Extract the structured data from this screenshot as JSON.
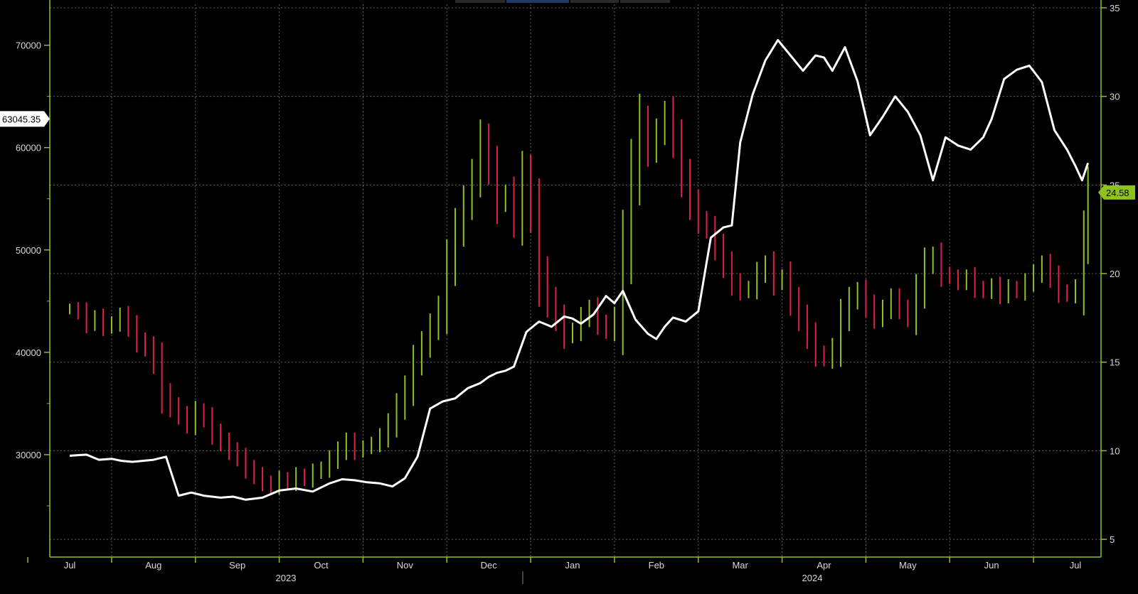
{
  "chart_data": {
    "type": "line",
    "title": "",
    "xlabel": "",
    "ylabel_left": "",
    "ylabel_right": "",
    "grid": true,
    "colors": {
      "background": "#000000",
      "axis": "#8fc21f",
      "grid": "#8a8a8a",
      "price_line": "#ffffff",
      "bar_up": "#8fc21f",
      "bar_down": "#e0204a",
      "label_right_bg": "#8fc21f"
    },
    "x_tick_labels": [
      "Jul",
      "Aug",
      "Sep",
      "Oct",
      "Nov",
      "Dec",
      "Jan",
      "Feb",
      "Mar",
      "Apr",
      "May",
      "Jun",
      "Jul"
    ],
    "x_year_labels": [
      "2023",
      "2024"
    ],
    "y_left": {
      "ticks": [
        "30000",
        "40000",
        "50000",
        "60000",
        "70000"
      ],
      "ylim": [
        20000,
        74000
      ],
      "last_value_label": "63045.35"
    },
    "y_right": {
      "ticks": [
        "5",
        "10",
        "15",
        "20",
        "25",
        "30",
        "35"
      ],
      "ylim": [
        4,
        35.2
      ],
      "last_value_label": "24.58"
    },
    "series": [
      {
        "axis": "left",
        "style": "line",
        "x_month_index": [
          0,
          0.2,
          0.35,
          0.5,
          0.62,
          0.75,
          1.0,
          1.15,
          1.3,
          1.45,
          1.6,
          1.8,
          1.95,
          2.1,
          2.3,
          2.5,
          2.7,
          2.9,
          3.1,
          3.25,
          3.4,
          3.55,
          3.7,
          3.85,
          4.0,
          4.15,
          4.3,
          4.45,
          4.6,
          4.75,
          4.9,
          5.0,
          5.1,
          5.2,
          5.3,
          5.45,
          5.6,
          5.75,
          5.9,
          6.0,
          6.1,
          6.25,
          6.4,
          6.5,
          6.6,
          6.75,
          6.9,
          7.0,
          7.1,
          7.2,
          7.35,
          7.5,
          7.65,
          7.8,
          7.9,
          8.0,
          8.15,
          8.3,
          8.45,
          8.6,
          8.75,
          8.9,
          9.0,
          9.1,
          9.25,
          9.4,
          9.55,
          9.7,
          9.85,
          10.0,
          10.15,
          10.3,
          10.45,
          10.6,
          10.75,
          10.9,
          11.0,
          11.15,
          11.3,
          11.45,
          11.6,
          11.75,
          11.9,
          12.0,
          12.08,
          12.15
        ],
        "values": [
          29900,
          30000,
          29500,
          29600,
          29400,
          29300,
          29500,
          29800,
          26000,
          26300,
          26000,
          25800,
          25900,
          25600,
          25800,
          26500,
          26700,
          26400,
          27200,
          27600,
          27500,
          27300,
          27200,
          26900,
          27700,
          29800,
          34500,
          35200,
          35500,
          36500,
          37000,
          37600,
          38000,
          38200,
          38600,
          42000,
          43000,
          42500,
          43500,
          43300,
          42800,
          43700,
          45500,
          44800,
          46000,
          43200,
          41800,
          41300,
          42500,
          43400,
          43000,
          44000,
          51200,
          52200,
          52400,
          60500,
          65200,
          68500,
          70500,
          69000,
          67500,
          69000,
          68800,
          67500,
          69800,
          66500,
          61200,
          63000,
          65000,
          63500,
          61200,
          56800,
          61000,
          60200,
          59800,
          61000,
          62800,
          66700,
          67600,
          68000,
          66400,
          61700,
          59800,
          58200,
          56800,
          58500,
          60000,
          63000,
          62800
        ]
      },
      {
        "axis": "right",
        "style": "bars",
        "x_month_index": [
          0,
          0.1,
          0.2,
          0.3,
          0.4,
          0.5,
          0.6,
          0.7,
          0.8,
          0.9,
          1.0,
          1.1,
          1.2,
          1.3,
          1.4,
          1.5,
          1.6,
          1.7,
          1.8,
          1.9,
          2.0,
          2.1,
          2.2,
          2.3,
          2.4,
          2.5,
          2.6,
          2.7,
          2.8,
          2.9,
          3.0,
          3.1,
          3.2,
          3.3,
          3.4,
          3.5,
          3.6,
          3.7,
          3.8,
          3.9,
          4.0,
          4.1,
          4.2,
          4.3,
          4.4,
          4.5,
          4.6,
          4.7,
          4.8,
          4.9,
          5.0,
          5.1,
          5.2,
          5.3,
          5.4,
          5.5,
          5.6,
          5.7,
          5.8,
          5.9,
          6.0,
          6.1,
          6.2,
          6.3,
          6.4,
          6.5,
          6.6,
          6.7,
          6.8,
          6.9,
          7.0,
          7.1,
          7.2,
          7.3,
          7.4,
          7.5,
          7.6,
          7.7,
          7.8,
          7.9,
          8.0,
          8.1,
          8.2,
          8.3,
          8.4,
          8.5,
          8.6,
          8.7,
          8.8,
          8.9,
          9.0,
          9.1,
          9.2,
          9.3,
          9.4,
          9.5,
          9.6,
          9.7,
          9.8,
          9.9,
          10.0,
          10.1,
          10.2,
          10.3,
          10.4,
          10.5,
          10.6,
          10.7,
          10.8,
          10.9,
          11.0,
          11.1,
          11.2,
          11.3,
          11.4,
          11.5,
          11.6,
          11.7,
          11.8,
          11.9,
          12.0,
          12.1,
          12.15
        ],
        "values": [
          18.0,
          17.8,
          17.2,
          17.5,
          17.0,
          17.2,
          17.6,
          17.0,
          16.2,
          15.8,
          15.0,
          13.2,
          12.5,
          12.0,
          11.5,
          12.2,
          11.8,
          11.0,
          10.5,
          10.0,
          9.6,
          9.0,
          8.6,
          8.2,
          8.0,
          8.4,
          8.2,
          8.6,
          8.4,
          8.8,
          9.0,
          9.5,
          10.0,
          10.5,
          10.0,
          10.2,
          10.4,
          10.8,
          11.5,
          12.5,
          13.5,
          15.0,
          16.0,
          17.0,
          18.0,
          20.5,
          22.5,
          24.0,
          25.5,
          27.5,
          26.0,
          24.0,
          24.5,
          23.0,
          25.5,
          23.5,
          20.0,
          18.5,
          17.5,
          16.5,
          16.8,
          17.5,
          18.0,
          17.2,
          16.8,
          17.5,
          21.5,
          25.5,
          28.5,
          27.0,
          28.0,
          29.0,
          27.5,
          25.5,
          24.0,
          23.0,
          22.5,
          21.5,
          20.5,
          19.5,
          19.0,
          19.2,
          20.0,
          20.5,
          19.5,
          19.8,
          18.5,
          17.5,
          16.5,
          15.5,
          15.2,
          15.8,
          17.5,
          18.5,
          19.0,
          18.2,
          17.5,
          18.0,
          18.6,
          18.0,
          17.5,
          19.0,
          20.5,
          21.0,
          20.0,
          19.8,
          19.5,
          19.8,
          19.2,
          19.0,
          19.3,
          18.8,
          19.2,
          19.0,
          19.5,
          20.0,
          20.5,
          19.8,
          19.0,
          18.8,
          19.2,
          22.0,
          24.58
        ]
      }
    ]
  }
}
